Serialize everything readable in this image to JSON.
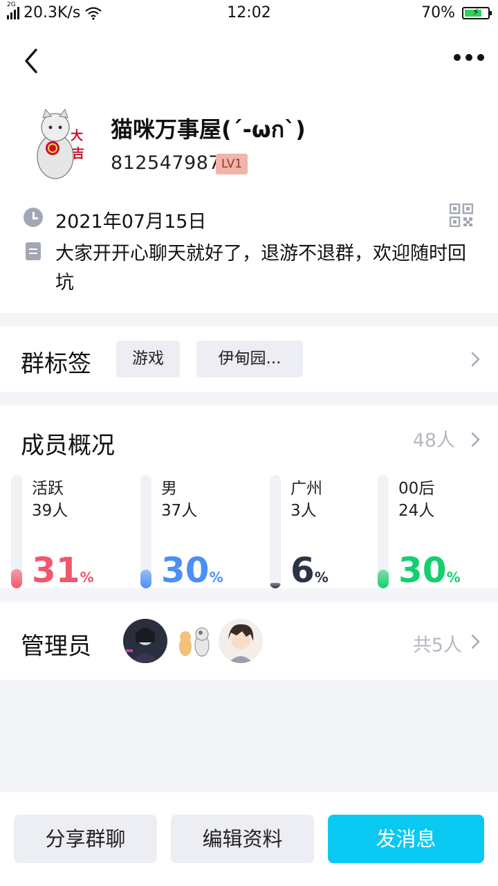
{
  "status_bar": {
    "network_type": "2G",
    "speed": "20.3K/s",
    "time": "12:02",
    "battery": "70%"
  },
  "header": {
    "back_icon": "chevron-left-icon",
    "more_icon": "more-dots-icon"
  },
  "group": {
    "name": "猫咪万事屋(´-ωก`)",
    "id": "812547987",
    "level": "LV1",
    "created_date": "2021年07月15日",
    "description": "大家开开心聊天就好了，退游不退群，欢迎随时回坑"
  },
  "tags": {
    "title": "群标签",
    "items": [
      "游戏",
      "伊甸园..."
    ]
  },
  "members": {
    "title": "成员概况",
    "count": "48人",
    "stats": [
      {
        "label": "活跃",
        "count": "39人",
        "percent": "31",
        "unit": "%",
        "color": "#f2566b"
      },
      {
        "label": "男",
        "count": "37人",
        "percent": "30",
        "unit": "%",
        "color": "#4d8ef5"
      },
      {
        "label": "广州",
        "count": "3人",
        "percent": "6",
        "unit": "%",
        "color": "#2d3346"
      },
      {
        "label": "00后",
        "count": "24人",
        "percent": "30",
        "unit": "%",
        "color": "#14cf6e"
      }
    ]
  },
  "admins": {
    "title": "管理员",
    "total": "共5人"
  },
  "actions": {
    "share": "分享群聊",
    "edit": "编辑资料",
    "message": "发消息"
  },
  "colors": {
    "accent": "#09c9f2",
    "muted": "#b5b8c2"
  }
}
